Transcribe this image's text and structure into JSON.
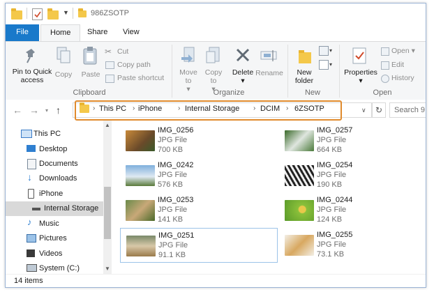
{
  "window": {
    "title": "986ZSOTP"
  },
  "tabs": [
    "File",
    "Home",
    "Share",
    "View"
  ],
  "ribbon": {
    "clipboard": {
      "label": "Clipboard",
      "pin": "Pin to Quick access",
      "copy": "Copy",
      "paste": "Paste",
      "cut": "Cut",
      "copy_path": "Copy path",
      "paste_shortcut": "Paste shortcut"
    },
    "organize": {
      "label": "Organize",
      "move_to": "Move to",
      "copy_to": "Copy to",
      "delete": "Delete",
      "rename": "Rename"
    },
    "new": {
      "label": "New",
      "new_folder": "New folder"
    },
    "open": {
      "label": "Open",
      "properties": "Properties",
      "open": "Open",
      "edit": "Edit",
      "history": "History"
    }
  },
  "address": {
    "crumbs": [
      "This PC",
      "iPhone",
      "Internal Storage",
      "DCIM",
      "6ZSOTP"
    ],
    "search_placeholder": "Search 9"
  },
  "nav": [
    {
      "label": "This PC",
      "icon": "computer-icon"
    },
    {
      "label": "Desktop",
      "icon": "desktop-icon"
    },
    {
      "label": "Documents",
      "icon": "documents-icon"
    },
    {
      "label": "Downloads",
      "icon": "downloads-icon"
    },
    {
      "label": "iPhone",
      "icon": "phone-icon"
    },
    {
      "label": "Internal Storage",
      "icon": "drive-icon"
    },
    {
      "label": "Music",
      "icon": "music-icon"
    },
    {
      "label": "Pictures",
      "icon": "pictures-icon"
    },
    {
      "label": "Videos",
      "icon": "videos-icon"
    },
    {
      "label": "System (C:)",
      "icon": "system-drive-icon"
    }
  ],
  "files": [
    {
      "name": "IMG_0256",
      "type": "JPG File",
      "size": "700 KB",
      "color": "#8a6a3a"
    },
    {
      "name": "IMG_0257",
      "type": "JPG File",
      "size": "664 KB",
      "color": "#4c7a3a"
    },
    {
      "name": "IMG_0242",
      "type": "JPG File",
      "size": "576 KB",
      "color": "#5a8fb8"
    },
    {
      "name": "IMG_0254",
      "type": "JPG File",
      "size": "190 KB",
      "color": "#6a8a4a"
    },
    {
      "name": "IMG_0253",
      "type": "JPG File",
      "size": "141 KB",
      "color": "#7a7a4a"
    },
    {
      "name": "IMG_0244",
      "type": "JPG File",
      "size": "124 KB",
      "color": "#8ac03a"
    },
    {
      "name": "IMG_0251",
      "type": "JPG File",
      "size": "91.1 KB",
      "color": "#9a8a5a"
    },
    {
      "name": "IMG_0255",
      "type": "JPG File",
      "size": "73.1 KB",
      "color": "#c89a5a"
    }
  ],
  "status": {
    "items": "14 items"
  }
}
